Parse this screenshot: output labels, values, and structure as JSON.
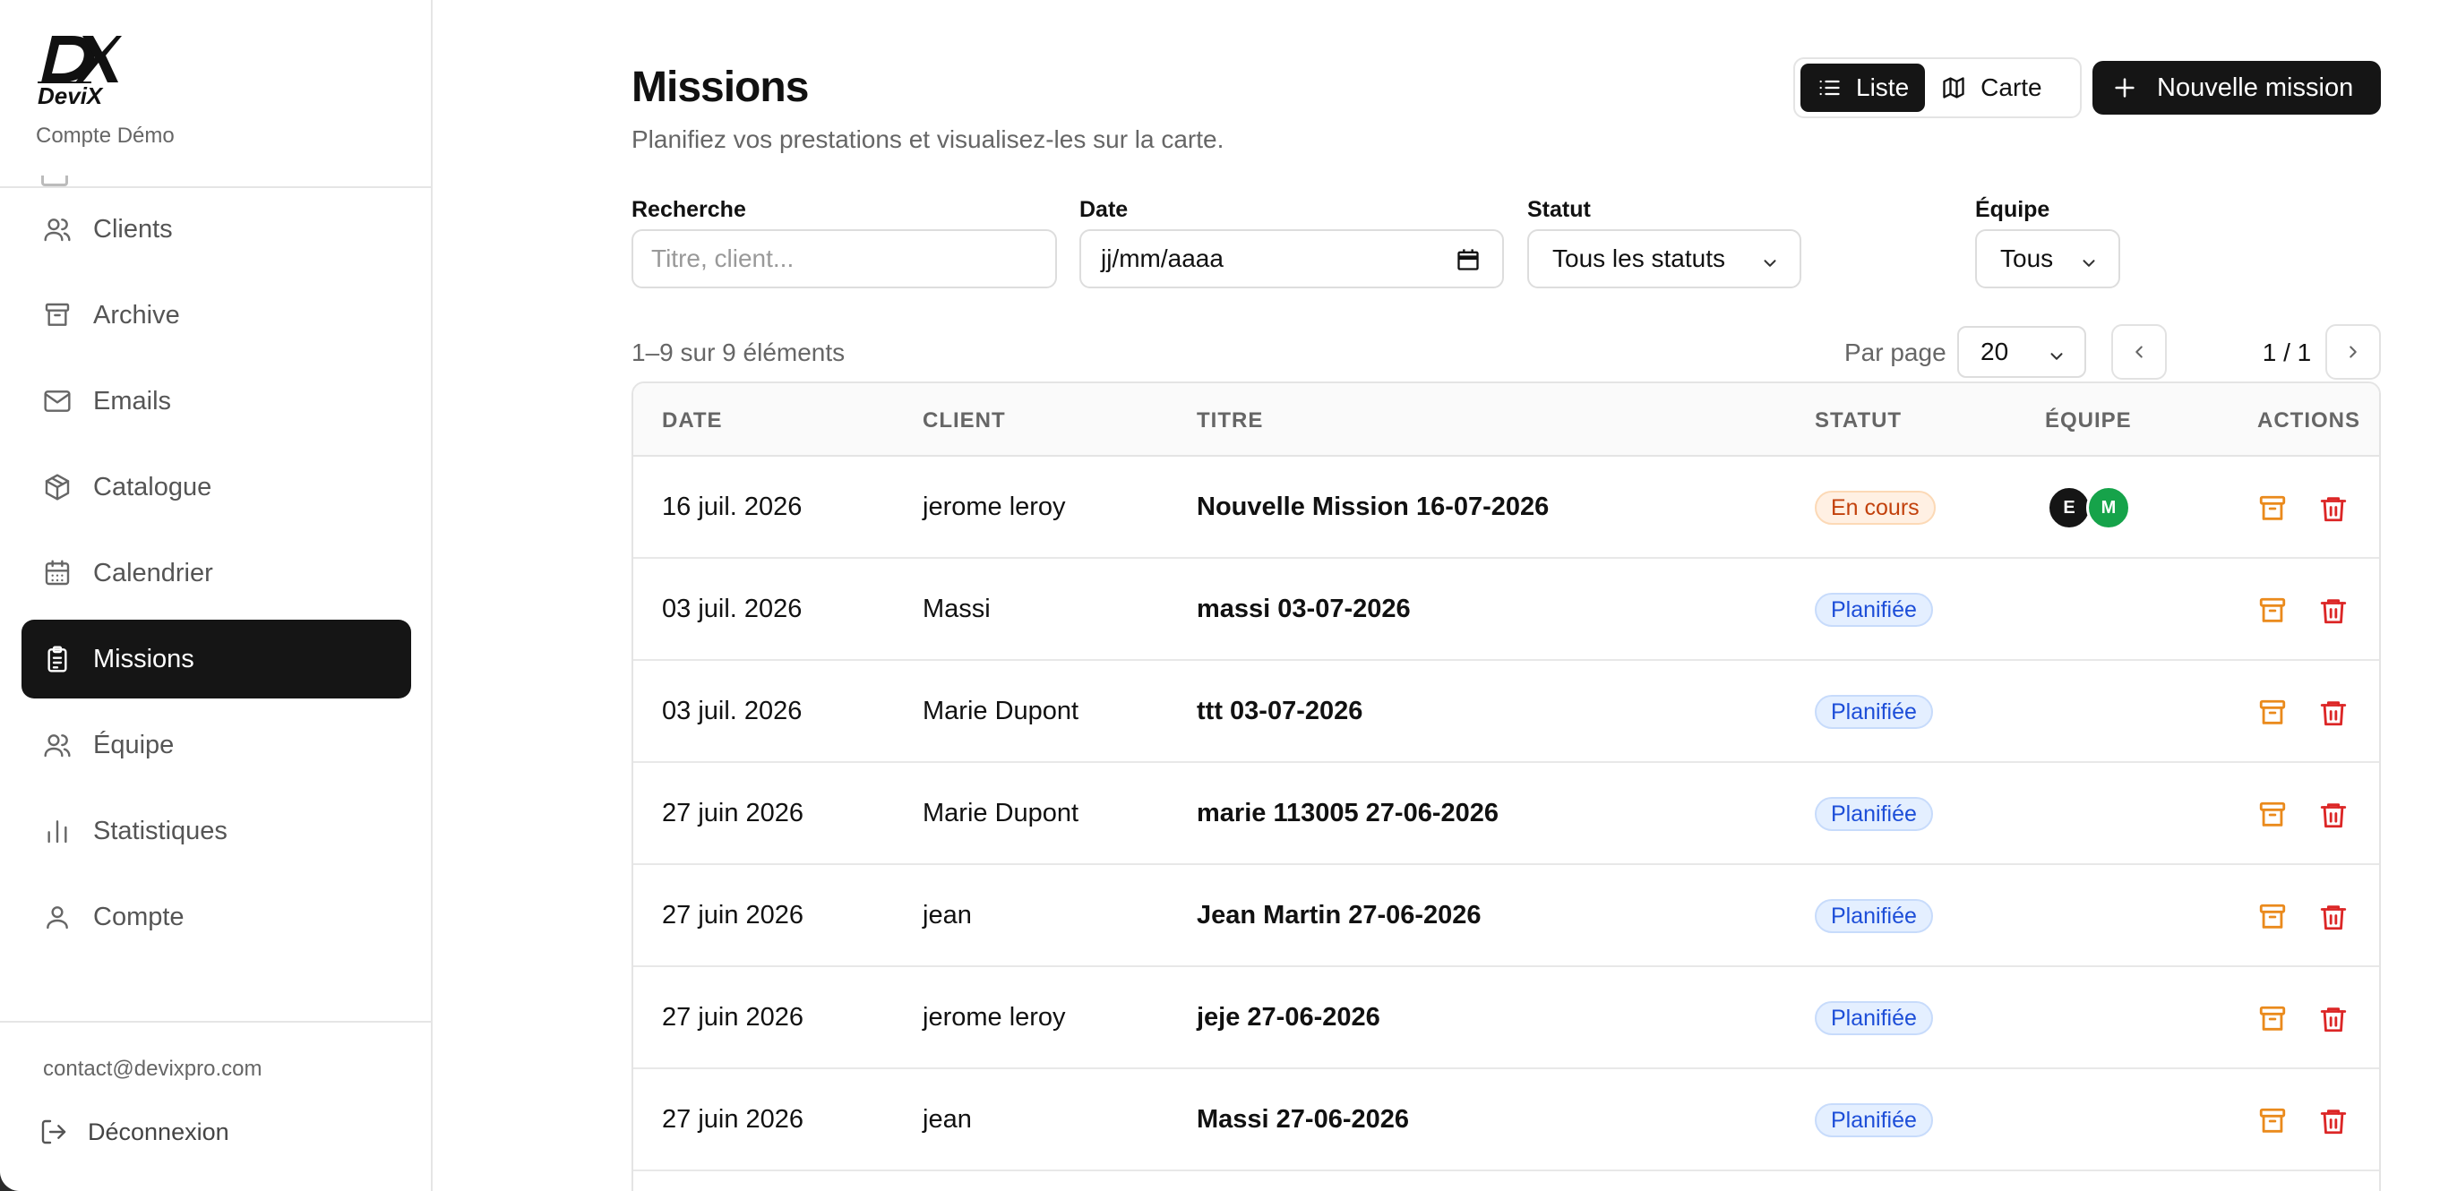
{
  "brand": {
    "name": "DeviX",
    "account": "Compte Démo"
  },
  "sidebar": {
    "items": [
      {
        "label": "Clients",
        "icon": "users-icon"
      },
      {
        "label": "Archive",
        "icon": "archive-icon"
      },
      {
        "label": "Emails",
        "icon": "mail-icon"
      },
      {
        "label": "Catalogue",
        "icon": "package-icon"
      },
      {
        "label": "Calendrier",
        "icon": "calendar-icon"
      },
      {
        "label": "Missions",
        "icon": "clipboard-icon",
        "active": true
      },
      {
        "label": "Équipe",
        "icon": "users-icon"
      },
      {
        "label": "Statistiques",
        "icon": "bar-chart-icon"
      },
      {
        "label": "Compte",
        "icon": "user-icon"
      }
    ],
    "email": "contact@devixpro.com",
    "logout": "Déconnexion"
  },
  "header": {
    "title": "Missions",
    "subtitle": "Planifiez vos prestations et visualisez-les sur la carte.",
    "view_list": "Liste",
    "view_map": "Carte",
    "new_button": "Nouvelle mission"
  },
  "filters": {
    "search_label": "Recherche",
    "search_placeholder": "Titre, client...",
    "date_label": "Date",
    "date_placeholder": "jj/mm/aaaa",
    "status_label": "Statut",
    "status_value": "Tous les statuts",
    "team_label": "Équipe",
    "team_value": "Tous"
  },
  "pagination": {
    "count_text": "1–9 sur 9 éléments",
    "per_page_label": "Par page",
    "per_page_value": "20",
    "page_text": "1 / 1"
  },
  "table": {
    "columns": [
      "DATE",
      "CLIENT",
      "TITRE",
      "STATUT",
      "ÉQUIPE",
      "ACTIONS"
    ],
    "rows": [
      {
        "date": "16 juil. 2026",
        "client": "jerome leroy",
        "title": "Nouvelle Mission 16-07-2026",
        "status": "En cours",
        "status_kind": "encours",
        "team": [
          "E",
          "M"
        ]
      },
      {
        "date": "03 juil. 2026",
        "client": "Massi",
        "title": "massi 03-07-2026",
        "status": "Planifiée",
        "status_kind": "planifiee",
        "team": []
      },
      {
        "date": "03 juil. 2026",
        "client": "Marie Dupont",
        "title": "ttt 03-07-2026",
        "status": "Planifiée",
        "status_kind": "planifiee",
        "team": []
      },
      {
        "date": "27 juin 2026",
        "client": "Marie Dupont",
        "title": "marie 113005 27-06-2026",
        "status": "Planifiée",
        "status_kind": "planifiee",
        "team": []
      },
      {
        "date": "27 juin 2026",
        "client": "jean",
        "title": "Jean Martin 27-06-2026",
        "status": "Planifiée",
        "status_kind": "planifiee",
        "team": []
      },
      {
        "date": "27 juin 2026",
        "client": "jerome leroy",
        "title": "jeje 27-06-2026",
        "status": "Planifiée",
        "status_kind": "planifiee",
        "team": []
      },
      {
        "date": "27 juin 2026",
        "client": "jean",
        "title": "Massi 27-06-2026",
        "status": "Planifiée",
        "status_kind": "planifiee",
        "team": []
      }
    ]
  },
  "colors": {
    "accent": "#151515",
    "archive_action": "#ea8a1c",
    "delete_action": "#dc2626",
    "avatar_e": "#151515",
    "avatar_m": "#16a34a"
  }
}
